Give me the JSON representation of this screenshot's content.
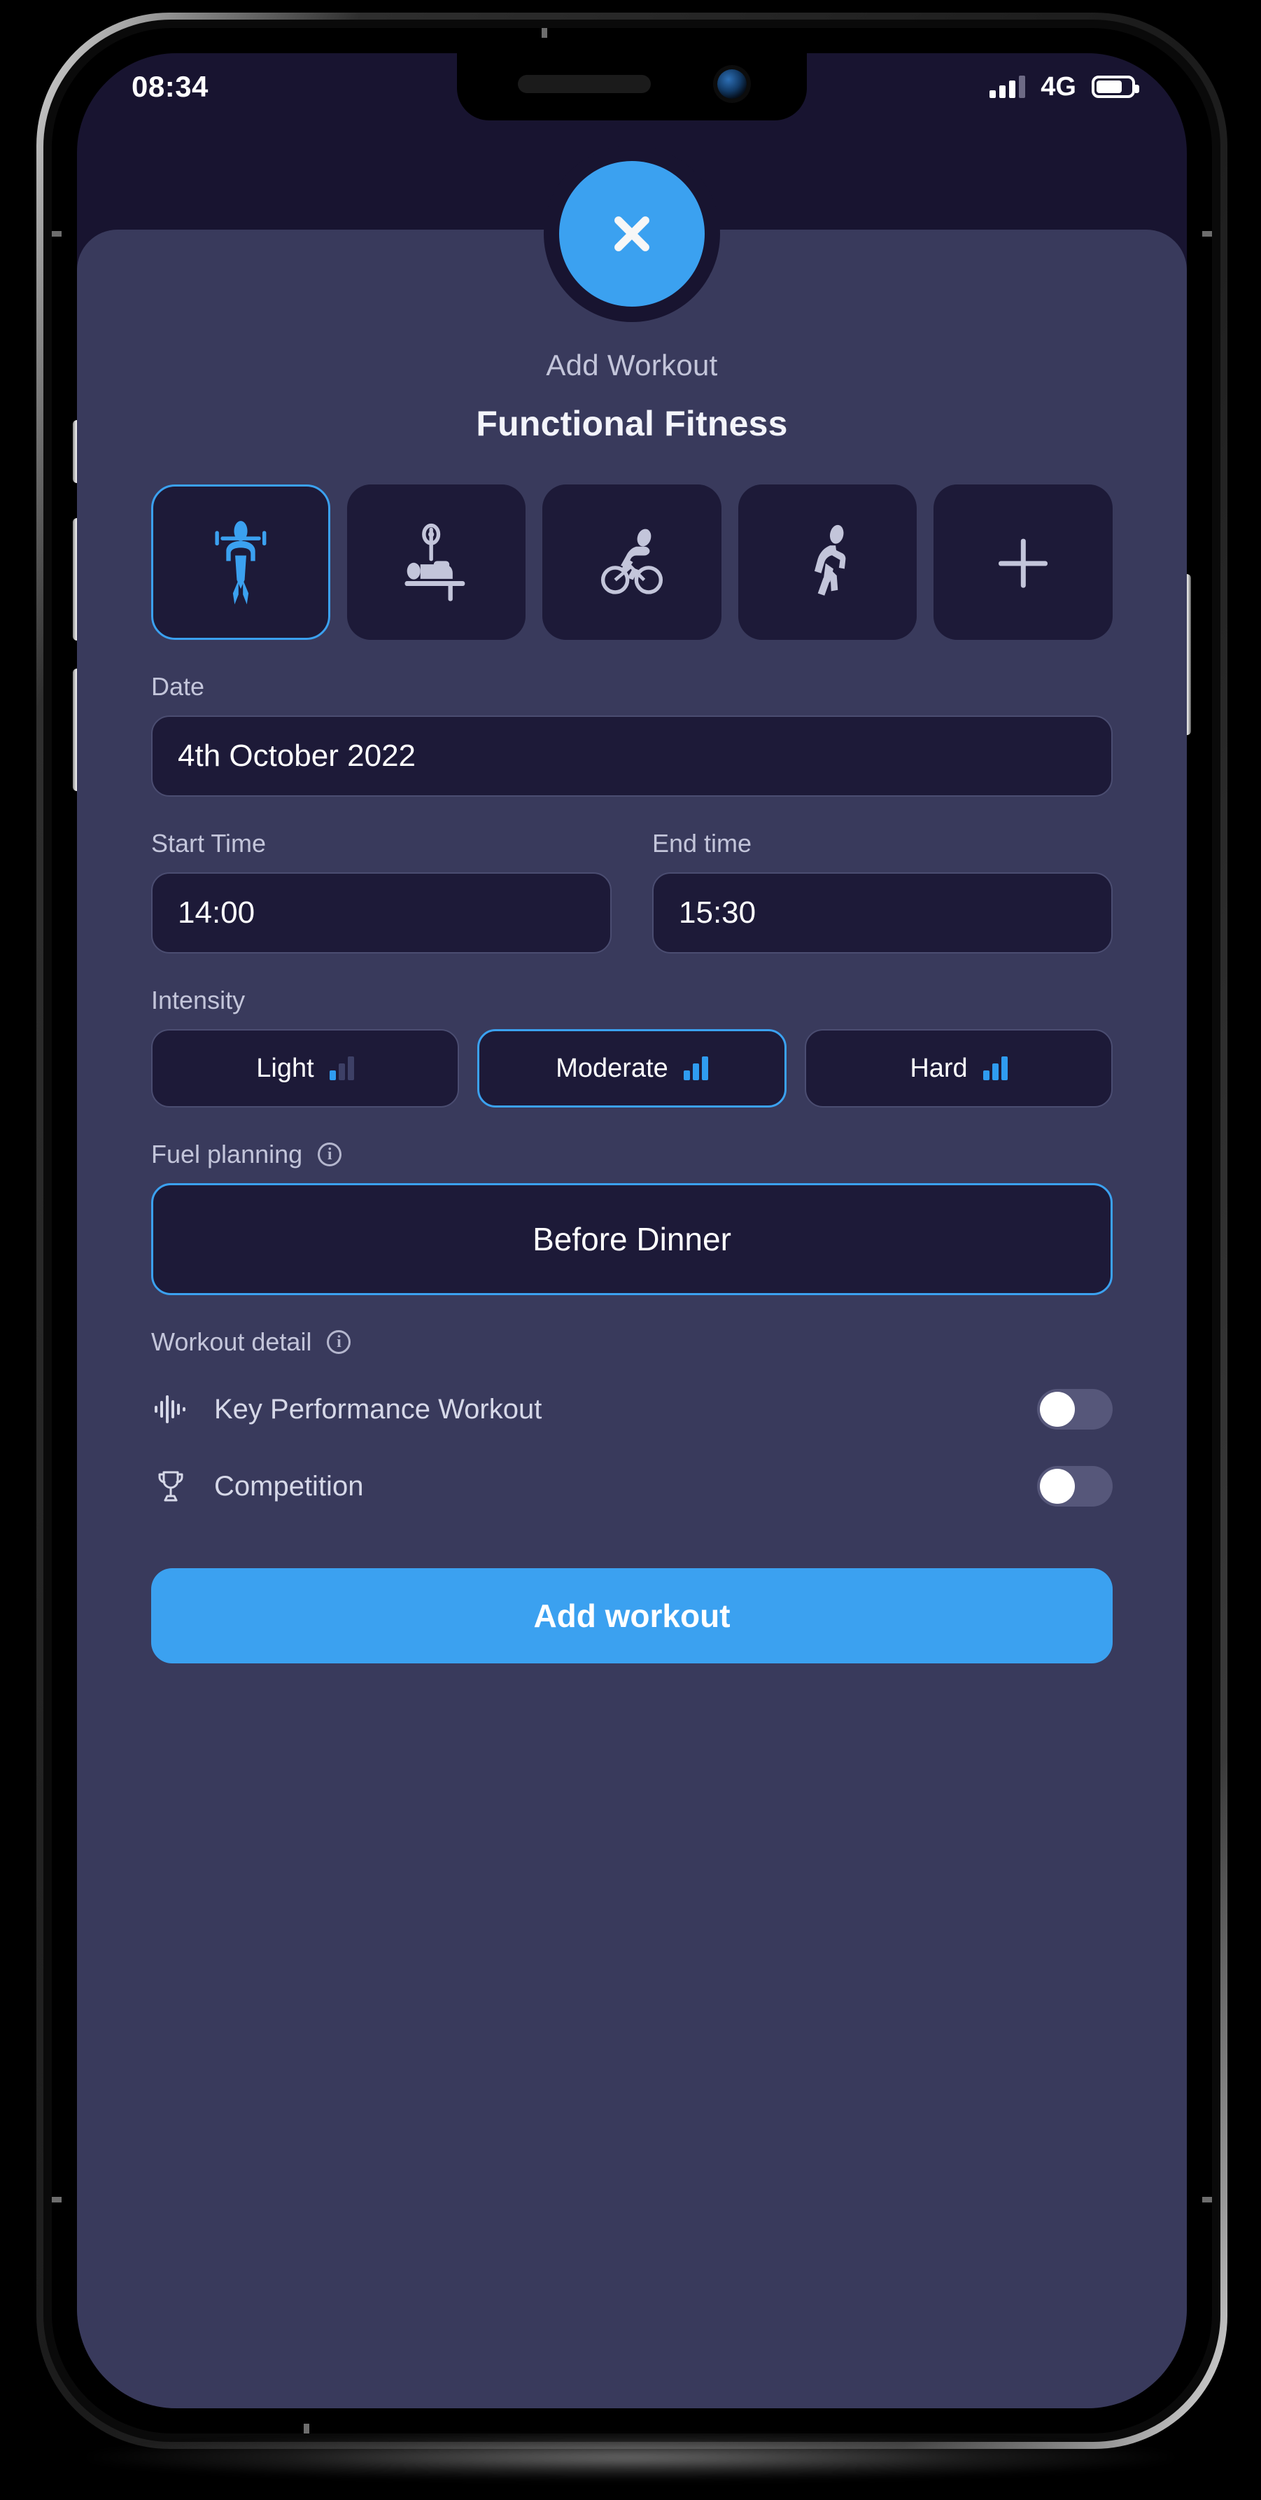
{
  "status_bar": {
    "time": "08:34",
    "network": "4G",
    "signal_icon": "signal-bars-icon",
    "battery_icon": "battery-icon"
  },
  "sheet": {
    "close_icon": "close-x-icon",
    "subtitle": "Add Workout",
    "title": "Functional Fitness"
  },
  "activities": [
    {
      "name": "functional-fitness",
      "icon": "pull-up-figure-icon",
      "selected": true
    },
    {
      "name": "weight-training",
      "icon": "bench-press-icon",
      "selected": false
    },
    {
      "name": "cycling",
      "icon": "cyclist-icon",
      "selected": false
    },
    {
      "name": "running",
      "icon": "runner-icon",
      "selected": false
    },
    {
      "name": "add-activity",
      "icon": "plus-icon",
      "selected": false
    }
  ],
  "date_field": {
    "label": "Date",
    "value": "4th October 2022"
  },
  "start_time_field": {
    "label": "Start Time",
    "value": "14:00"
  },
  "end_time_field": {
    "label": "End time",
    "value": "15:30"
  },
  "intensity": {
    "label": "Intensity",
    "options": [
      {
        "label": "Light",
        "level": 1,
        "selected": false
      },
      {
        "label": "Moderate",
        "level": 2,
        "selected": true
      },
      {
        "label": "Hard",
        "level": 3,
        "selected": false
      }
    ]
  },
  "fuel_planning": {
    "label": "Fuel planning",
    "info_icon": "info-circle-icon",
    "value": "Before Dinner"
  },
  "workout_detail": {
    "label": "Workout detail",
    "info_icon": "info-circle-icon",
    "rows": [
      {
        "label": "Key Performance Workout",
        "icon": "waveform-icon",
        "enabled": false
      },
      {
        "label": "Competition",
        "icon": "trophy-icon",
        "enabled": false
      }
    ]
  },
  "primary_action": {
    "label": "Add workout"
  },
  "colors": {
    "accent": "#3ba1f0",
    "sheet_bg": "#393a5c",
    "screen_bg": "#181430",
    "field_bg": "#1d1a38",
    "muted_text": "#c3c5da"
  }
}
